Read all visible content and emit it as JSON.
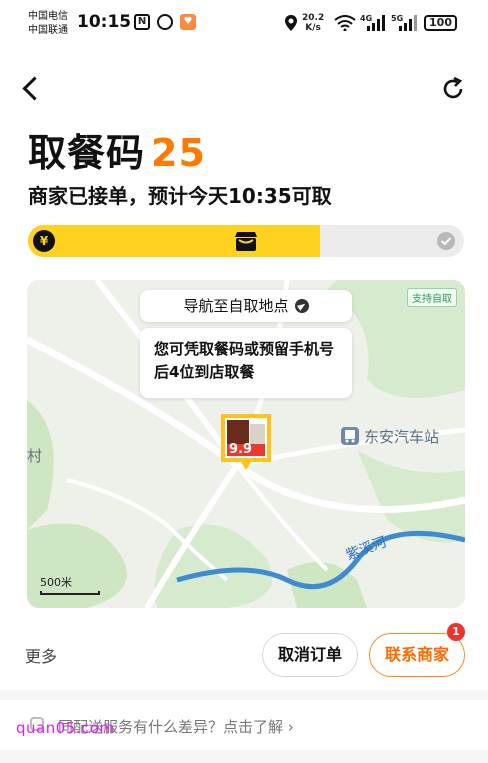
{
  "status_bar": {
    "carrier_1": "中国电信",
    "carrier_2": "中国联通",
    "time": "10:15",
    "net_speed_value": "20.2",
    "net_speed_unit": "K/s",
    "signal_1": "4G",
    "signal_2": "5G",
    "battery": "100"
  },
  "header": {
    "title": "取餐码",
    "pickup_code": "25",
    "subtitle": "商家已接单，预计今天10:35可取"
  },
  "progress": {
    "fraction": 0.67,
    "step_1_icon": "yen-icon",
    "step_2_icon": "shop-icon",
    "step_3_icon": "check-icon",
    "yen_glyph": "¥"
  },
  "map": {
    "self_pickup_tag": "支持自取",
    "navigate_label": "导航至自取地点",
    "pickup_hint": "您可凭取餐码或预留手机号后4位到店取餐",
    "bus_station": "东安汽车站",
    "village_label": "村",
    "river_label": "紫溪河",
    "scale_label": "500米",
    "marker_price": "9.9"
  },
  "actions": {
    "more_label": "更多",
    "cancel_label": "取消订单",
    "contact_label": "联系商家",
    "contact_badge": "1"
  },
  "info_bar": {
    "text": "同配送服务有什么差异？点击了解",
    "chevron": "›"
  },
  "watermark": "quan05.com",
  "colors": {
    "accent": "#ff7b00",
    "progress_fill": "#ffd21f",
    "contact_border": "#ff8a1d",
    "badge": "#f0322c"
  }
}
